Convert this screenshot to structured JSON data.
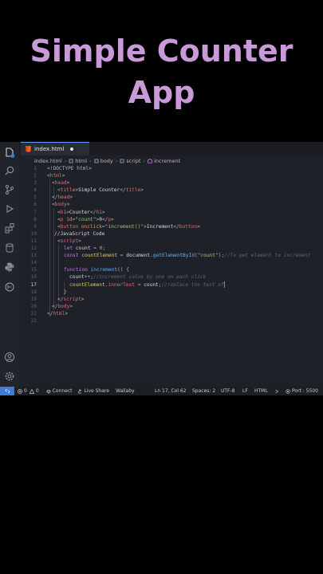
{
  "title": {
    "line1": "Simple Counter",
    "line2": "App"
  },
  "tab": {
    "filename": "index.html"
  },
  "breadcrumb": [
    "index.html",
    "html",
    "body",
    "script",
    "increment"
  ],
  "status": {
    "errors": "0",
    "warnings": "0",
    "connect": "Connect",
    "live_share": "Live Share",
    "wallaby": "Wallaby",
    "position": "Ln 17, Col 62",
    "spaces": "Spaces: 2",
    "encoding": "UTF-8",
    "eol": "LF",
    "language": "HTML",
    "port": "Port : 5500"
  },
  "code": {
    "active_line": 17,
    "line_numbers": [
      "1",
      "2",
      "3",
      "4",
      "5",
      "6",
      "7",
      "8",
      "9",
      "10",
      "11",
      "12",
      "13",
      "14",
      "15",
      "16",
      "17",
      "18",
      "19",
      "20",
      "21",
      "22"
    ],
    "l1": "<!DOCTYPE html>",
    "l2": {
      "a": "<",
      "b": "html",
      "c": ">"
    },
    "l3": {
      "a": "<",
      "b": "head",
      "c": ">"
    },
    "l4": {
      "a": "<",
      "b": "title",
      "c": ">",
      "d": "Simple Counter",
      "e": "</",
      "f": "title",
      "g": ">"
    },
    "l5": {
      "a": "</",
      "b": "head",
      "c": ">"
    },
    "l6": {
      "a": "<",
      "b": "body",
      "c": ">"
    },
    "l7": {
      "a": "<",
      "b": "h1",
      "c": ">",
      "d": "Counter",
      "e": "</",
      "f": "h1",
      "g": ">"
    },
    "l8": {
      "a": "<",
      "b": "p",
      "c": " id",
      "d": "=",
      "e": "\"count\"",
      "f": ">",
      "g": "0",
      "h": "</",
      "i": "p",
      "j": ">"
    },
    "l9": {
      "a": "<",
      "b": "button",
      "c": " onclick",
      "d": "=",
      "e": "\"increment()\"",
      "f": ">",
      "g": "Increment",
      "h": "</",
      "i": "button",
      "j": ">"
    },
    "l10": "//JavaScript Code",
    "l11": {
      "a": "<",
      "b": "script",
      "c": ">"
    },
    "l12": {
      "a": "let ",
      "b": "count",
      "c": " = ",
      "d": "0",
      "e": ";"
    },
    "l13": {
      "a": "const ",
      "b": "countElement",
      "c": " = ",
      "d": "document",
      "e": ".",
      "f": "getElementById",
      "g": "(",
      "h": "\"count\"",
      "i": ");",
      "j": "//To get element to increment"
    },
    "l15": {
      "a": "function ",
      "b": "increment",
      "c": "() {"
    },
    "l16": {
      "a": "count",
      "b": "++;",
      "c": "//increment value by one on each click"
    },
    "l17": {
      "a": "countElement",
      "b": ".",
      "c": "innerText",
      "d": " = ",
      "e": "count",
      "f": ";",
      "g": "//replace the text of"
    },
    "l18": "}",
    "l19": {
      "a": "</",
      "b": "script",
      "c": ">"
    },
    "l20": {
      "a": "</",
      "b": "body",
      "c": ">"
    },
    "l21": {
      "a": "</",
      "b": "html",
      "c": ">"
    }
  },
  "colors": {
    "accent": "#3d7bd9",
    "title": "#c89ad8",
    "editor_bg": "#1e2128"
  },
  "icons": [
    "explorer-icon",
    "search-icon",
    "source-control-icon",
    "run-debug-icon",
    "extensions-icon",
    "database-icon",
    "python-icon",
    "gitlens-icon",
    "account-icon",
    "settings-icon",
    "html5-icon",
    "remote-icon"
  ]
}
